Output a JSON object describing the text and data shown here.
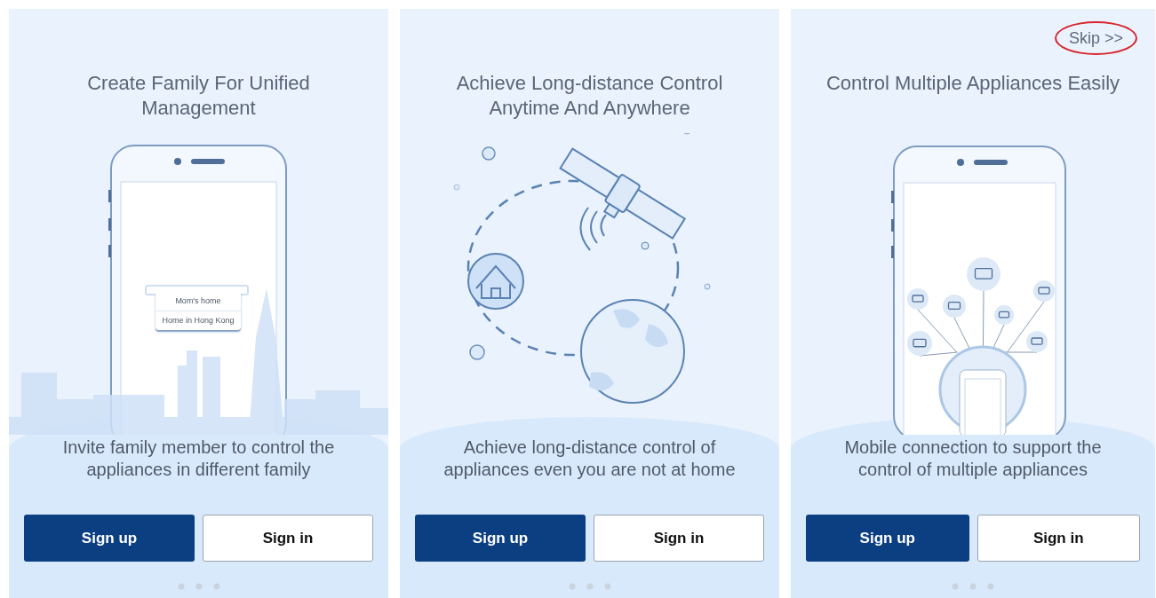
{
  "panels": [
    {
      "kind": "family",
      "title": "Create Family For Unified Management",
      "menu_items": [
        "Mom's home",
        "Home in Hong Kong"
      ],
      "description": "Invite family member to control the appliances in different family",
      "buttons": [
        {
          "label": "Sign up",
          "kind": "primary"
        },
        {
          "label": "Sign in",
          "kind": "secondary"
        }
      ]
    },
    {
      "kind": "remote",
      "title": "Achieve Long-distance Control Anytime And Anywhere",
      "description": "Achieve long-distance control of appliances even you are not at home",
      "buttons": [
        {
          "label": "Sign up",
          "kind": "primary"
        },
        {
          "label": "Sign in",
          "kind": "secondary"
        }
      ]
    },
    {
      "kind": "appliances",
      "skip": {
        "label": "Skip >>",
        "circled": true
      },
      "title": "Control Multiple Appliances Easily",
      "description": "Mobile connection to support the control of multiple appliances",
      "buttons": [
        {
          "label": "Sign up",
          "kind": "primary"
        },
        {
          "label": "Sign in",
          "kind": "secondary"
        }
      ]
    }
  ]
}
